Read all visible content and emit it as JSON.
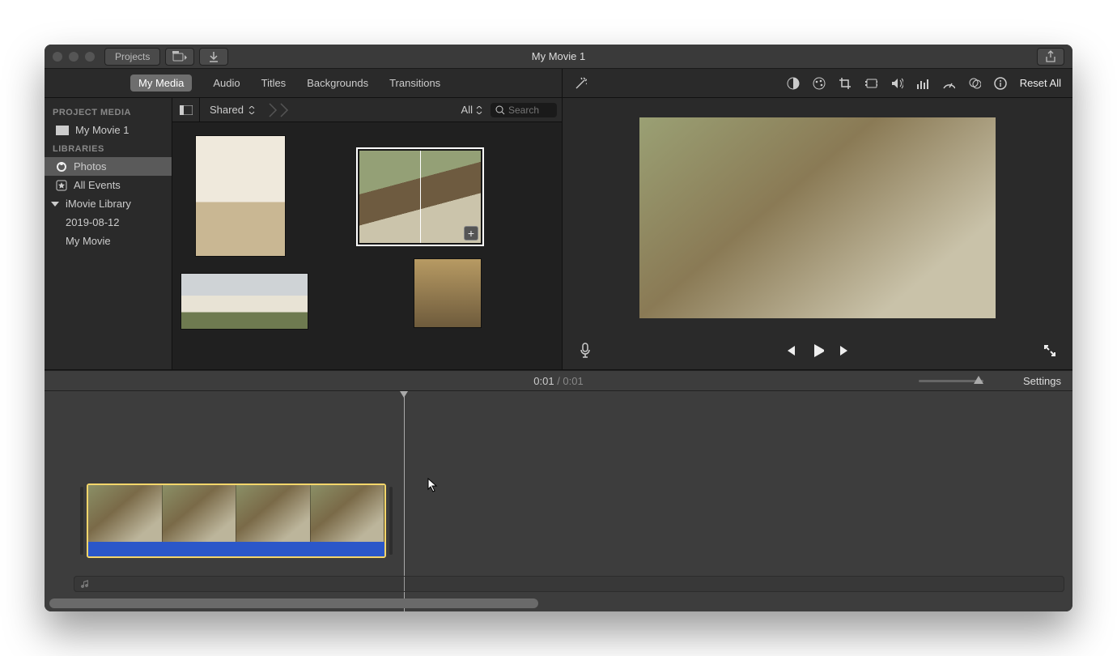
{
  "window": {
    "title": "My Movie 1"
  },
  "toolbar": {
    "projects_label": "Projects"
  },
  "tabs": {
    "items": [
      "My Media",
      "Audio",
      "Titles",
      "Backgrounds",
      "Transitions"
    ],
    "active": 0,
    "reset_label": "Reset All"
  },
  "sidebar": {
    "heading1": "PROJECT MEDIA",
    "project_name": "My Movie 1",
    "heading2": "LIBRARIES",
    "photos_label": "Photos",
    "all_events_label": "All Events",
    "library_label": "iMovie Library",
    "events": [
      "2019-08-12",
      "My Movie"
    ]
  },
  "browser": {
    "crumb": "Shared",
    "filter_all": "All",
    "search_placeholder": "Search"
  },
  "timebar": {
    "current": "0:01",
    "total": "0:01",
    "settings_label": "Settings"
  },
  "icons": {
    "wand": "wand-icon",
    "contrast": "contrast-icon",
    "palette": "palette-icon",
    "crop": "crop-icon",
    "stabilize": "stabilize-icon",
    "volume": "volume-icon",
    "eq": "eq-icon",
    "speed": "speed-icon",
    "filters": "filters-icon",
    "info": "info-icon",
    "share": "share-icon",
    "mic": "mic-icon",
    "prev": "prev-icon",
    "play": "play-icon",
    "next": "next-icon",
    "fullscreen": "fullscreen-icon",
    "layout": "layout-icon",
    "import": "import-icon",
    "download": "download-icon",
    "search": "search-icon",
    "music": "music-icon"
  }
}
